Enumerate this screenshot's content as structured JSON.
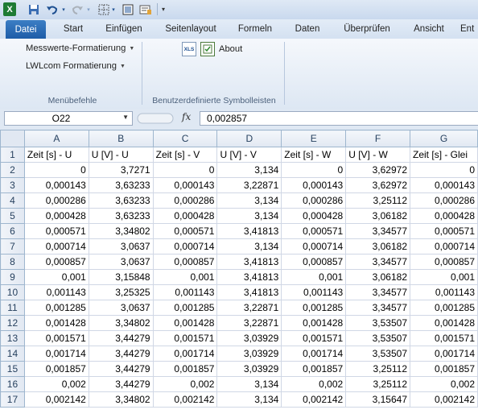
{
  "quick_access": {
    "app_icon": "excel-logo-icon",
    "app_letter": "X",
    "items": [
      "save-icon",
      "undo-icon",
      "redo-icon",
      "borders-icon",
      "table-icon",
      "form-icon",
      "customize-qat-icon"
    ]
  },
  "tabs": [
    "Datei",
    "Start",
    "Einfügen",
    "Seitenlayout",
    "Formeln",
    "Daten",
    "Überprüfen",
    "Ansicht",
    "Ent"
  ],
  "ribbon": {
    "group1": {
      "items": [
        "Messwerte-Formatierung",
        "LWLcom Formatierung"
      ],
      "label": "Menübefehle"
    },
    "group2": {
      "xls_icon_text": "XLS",
      "about_label": "About",
      "label": "Benutzerdefinierte Symbolleisten"
    }
  },
  "formula_bar": {
    "name_box": "O22",
    "fx_symbol": "fx",
    "value": "0,002857"
  },
  "sheet": {
    "columns": [
      "A",
      "B",
      "C",
      "D",
      "E",
      "F",
      "G"
    ],
    "header_row": [
      "Zeit [s] - U",
      "U [V] - U",
      "Zeit [s] - V",
      "U [V] - V",
      "Zeit [s] - W",
      "U [V] - W",
      "Zeit [s] - Glei"
    ],
    "row_numbers": [
      "1",
      "2",
      "3",
      "4",
      "5",
      "6",
      "7",
      "8",
      "9",
      "10",
      "11",
      "12",
      "13",
      "14",
      "15",
      "16",
      "17"
    ],
    "rows": [
      [
        "0",
        "3,7271",
        "0",
        "3,134",
        "0",
        "3,62972",
        "0"
      ],
      [
        "0,000143",
        "3,63233",
        "0,000143",
        "3,22871",
        "0,000143",
        "3,62972",
        "0,000143"
      ],
      [
        "0,000286",
        "3,63233",
        "0,000286",
        "3,134",
        "0,000286",
        "3,25112",
        "0,000286"
      ],
      [
        "0,000428",
        "3,63233",
        "0,000428",
        "3,134",
        "0,000428",
        "3,06182",
        "0,000428"
      ],
      [
        "0,000571",
        "3,34802",
        "0,000571",
        "3,41813",
        "0,000571",
        "3,34577",
        "0,000571"
      ],
      [
        "0,000714",
        "3,0637",
        "0,000714",
        "3,134",
        "0,000714",
        "3,06182",
        "0,000714"
      ],
      [
        "0,000857",
        "3,0637",
        "0,000857",
        "3,41813",
        "0,000857",
        "3,34577",
        "0,000857"
      ],
      [
        "0,001",
        "3,15848",
        "0,001",
        "3,41813",
        "0,001",
        "3,06182",
        "0,001"
      ],
      [
        "0,001143",
        "3,25325",
        "0,001143",
        "3,41813",
        "0,001143",
        "3,34577",
        "0,001143"
      ],
      [
        "0,001285",
        "3,0637",
        "0,001285",
        "3,22871",
        "0,001285",
        "3,34577",
        "0,001285"
      ],
      [
        "0,001428",
        "3,34802",
        "0,001428",
        "3,22871",
        "0,001428",
        "3,53507",
        "0,001428"
      ],
      [
        "0,001571",
        "3,44279",
        "0,001571",
        "3,03929",
        "0,001571",
        "3,53507",
        "0,001571"
      ],
      [
        "0,001714",
        "3,44279",
        "0,001714",
        "3,03929",
        "0,001714",
        "3,53507",
        "0,001714"
      ],
      [
        "0,001857",
        "3,44279",
        "0,001857",
        "3,03929",
        "0,001857",
        "3,25112",
        "0,001857"
      ],
      [
        "0,002",
        "3,44279",
        "0,002",
        "3,134",
        "0,002",
        "3,25112",
        "0,002"
      ],
      [
        "0,002142",
        "3,34802",
        "0,002142",
        "3,134",
        "0,002142",
        "3,15647",
        "0,002142"
      ]
    ]
  },
  "colors": {
    "file_tab": "#1e5da8",
    "excel_green": "#1e7b34",
    "header_bg": "#e1e8f2",
    "gridline": "#d0d7e5"
  }
}
